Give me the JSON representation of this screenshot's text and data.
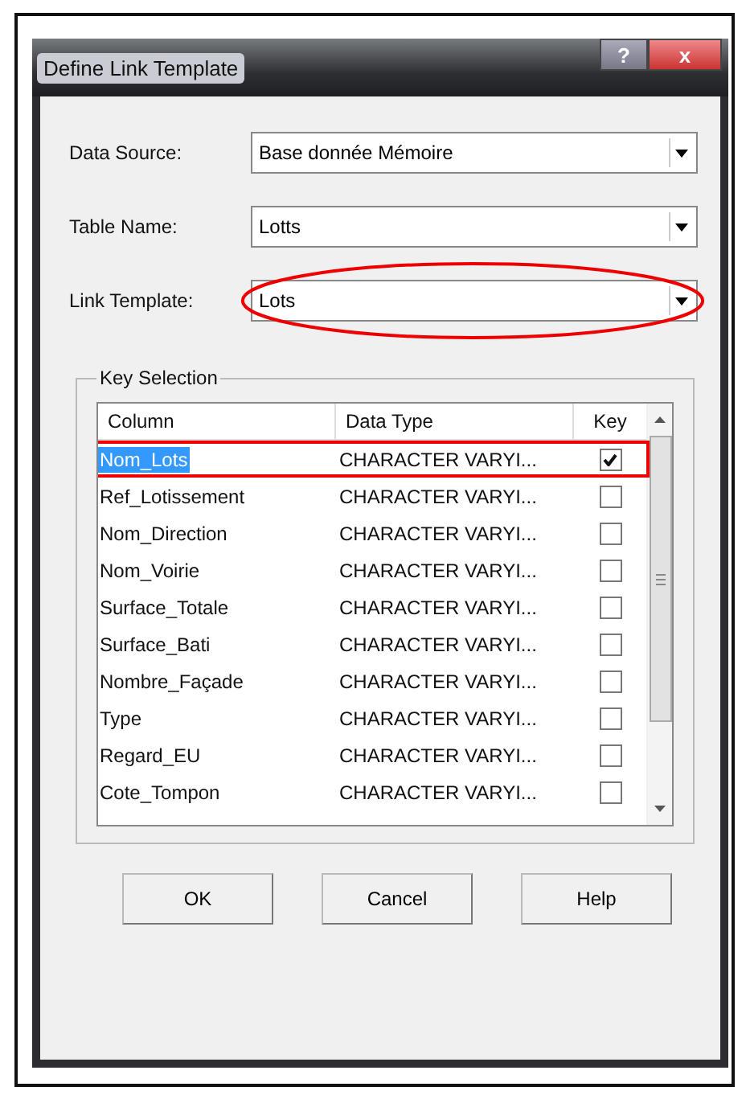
{
  "window": {
    "title": "Define Link Template"
  },
  "title_buttons": [
    {
      "kind": "help",
      "label": "?"
    },
    {
      "kind": "close",
      "label": "x"
    }
  ],
  "fields": [
    {
      "label": "Data Source:",
      "value": "Base donnée Mémoire",
      "circled": false
    },
    {
      "label": "Table Name:",
      "value": "Lotts",
      "circled": false
    },
    {
      "label": "Link Template:",
      "value": "Lots",
      "circled": true
    }
  ],
  "key_selection": {
    "title": "Key Selection",
    "columns": [
      "Column",
      "Data Type",
      "Key"
    ],
    "rows": [
      {
        "column": "Nom_Lots",
        "data_type": "CHARACTER VARYI...",
        "checked": true,
        "selected": true,
        "boxed": true
      },
      {
        "column": "Ref_Lotissement",
        "data_type": "CHARACTER VARYI...",
        "checked": false,
        "selected": false,
        "boxed": false
      },
      {
        "column": "Nom_Direction",
        "data_type": "CHARACTER VARYI...",
        "checked": false,
        "selected": false,
        "boxed": false
      },
      {
        "column": "Nom_Voirie",
        "data_type": "CHARACTER VARYI...",
        "checked": false,
        "selected": false,
        "boxed": false
      },
      {
        "column": "Surface_Totale",
        "data_type": "CHARACTER VARYI...",
        "checked": false,
        "selected": false,
        "boxed": false
      },
      {
        "column": "Surface_Bati",
        "data_type": "CHARACTER VARYI...",
        "checked": false,
        "selected": false,
        "boxed": false
      },
      {
        "column": "Nombre_Façade",
        "data_type": "CHARACTER VARYI...",
        "checked": false,
        "selected": false,
        "boxed": false
      },
      {
        "column": "Type",
        "data_type": "CHARACTER VARYI...",
        "checked": false,
        "selected": false,
        "boxed": false
      },
      {
        "column": "Regard_EU",
        "data_type": "CHARACTER VARYI...",
        "checked": false,
        "selected": false,
        "boxed": false
      },
      {
        "column": "Cote_Tompon",
        "data_type": "CHARACTER VARYI...",
        "checked": false,
        "selected": false,
        "boxed": false
      }
    ]
  },
  "buttons": [
    "OK",
    "Cancel",
    "Help"
  ]
}
